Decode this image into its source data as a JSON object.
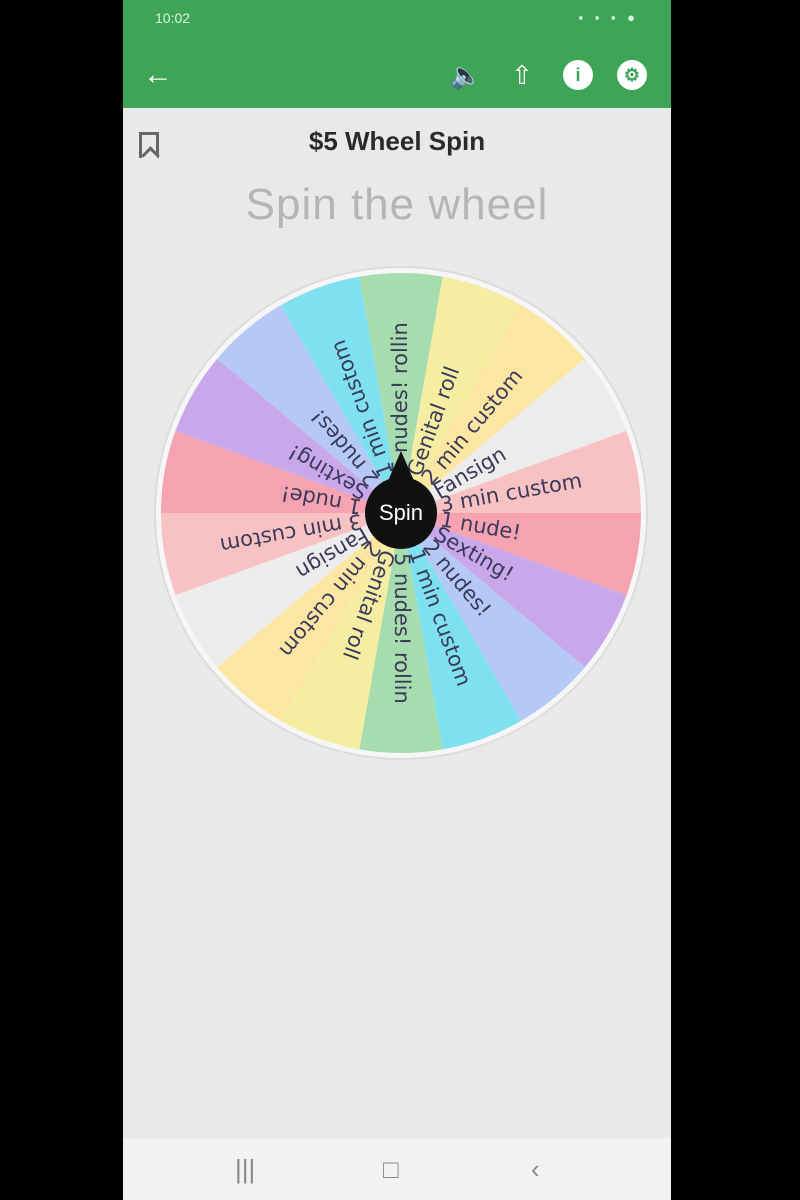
{
  "status_bar": {
    "time": "10:02",
    "icons": "▪ ▪ ▪ ●"
  },
  "toolbar": {
    "back_icon": "arrow-left-icon",
    "volume_icon": "volume-icon",
    "share_icon": "share-icon",
    "info_icon": "info-icon",
    "settings_icon": "settings-icon"
  },
  "header": {
    "title": "$5 Wheel Spin"
  },
  "main": {
    "subtitle": "Spin the wheel"
  },
  "wheel": {
    "center_label": "Spin",
    "segments": [
      {
        "label": "5 nudes! rollin",
        "color": "#a6dcae"
      },
      {
        "label": "Genital roll",
        "color": "#f5eea2"
      },
      {
        "label": "2 min custom",
        "color": "#fde5a2"
      },
      {
        "label": "Fansign",
        "color": "#ececec"
      },
      {
        "label": "3 min custom",
        "color": "#f9c2c2"
      },
      {
        "label": "1 nude!",
        "color": "#f5a3b1"
      },
      {
        "label": "Sexting!",
        "color": "#c8a8ea"
      },
      {
        "label": "2 nudes!",
        "color": "#b6c8f6"
      },
      {
        "label": "1 min custom",
        "color": "#7fe1f0"
      },
      {
        "label": "5 nudes! rollin",
        "color": "#a6dcae"
      },
      {
        "label": "Genital roll",
        "color": "#f5eea2"
      },
      {
        "label": "2 min custom",
        "color": "#fde5a2"
      },
      {
        "label": "Fansign",
        "color": "#ececec"
      },
      {
        "label": "3 min custom",
        "color": "#f9c2c2"
      },
      {
        "label": "1 nude!",
        "color": "#f5a3b1"
      },
      {
        "label": "Sexting!",
        "color": "#c8a8ea"
      },
      {
        "label": "2 nudes!",
        "color": "#b6c8f6"
      },
      {
        "label": "1 min custom",
        "color": "#7fe1f0"
      }
    ]
  },
  "nav_bar": {
    "recents": "|||",
    "home": "□",
    "back": "‹"
  }
}
